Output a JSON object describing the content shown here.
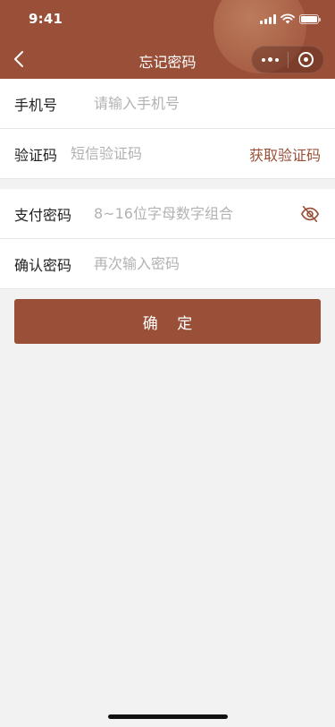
{
  "status_bar": {
    "time": "9:41"
  },
  "nav": {
    "title": "忘记密码",
    "back_icon": "chevron-left-icon",
    "more_icon": "more-dots-icon",
    "close_icon": "target-close-icon"
  },
  "form": {
    "phone": {
      "label": "手机号",
      "placeholder": "请输入手机号",
      "value": ""
    },
    "code": {
      "label": "验证码",
      "placeholder": "短信验证码",
      "value": "",
      "action_label": "获取验证码"
    },
    "pay_password": {
      "label": "支付密码",
      "placeholder": "8~16位字母数字组合",
      "value": "",
      "toggle_icon": "eye-off-icon"
    },
    "confirm_password": {
      "label": "确认密码",
      "placeholder": "再次输入密码",
      "value": ""
    }
  },
  "confirm_button": {
    "label": "确 定"
  },
  "colors": {
    "brand": "#9a5038",
    "background": "#f2f2f2",
    "placeholder": "#b2b2b2",
    "text": "#222222"
  }
}
